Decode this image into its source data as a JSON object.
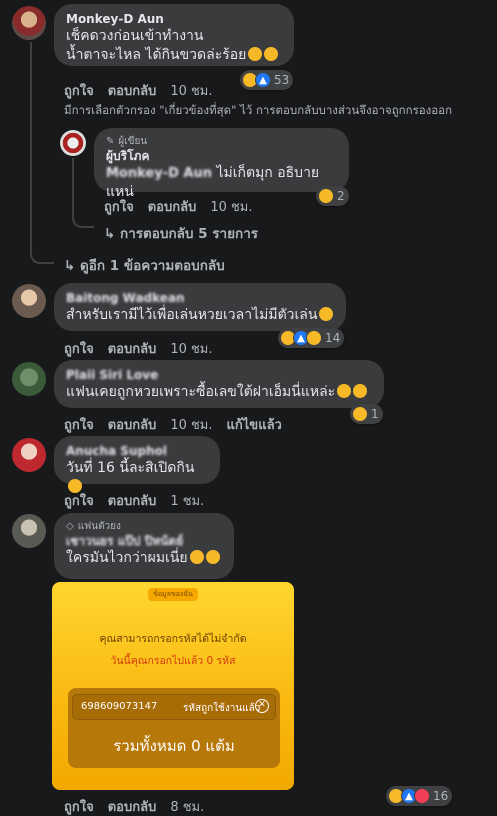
{
  "comments": [
    {
      "name": "Monkey-D Aun",
      "lines": [
        "เช็คดวงก่อนเข้าทำงาน",
        "น้ำตาจะไหล ได้กินขวดล่ะร้อย"
      ],
      "reaction_count": "53",
      "like": "ถูกใจ",
      "reply": "ตอบกลับ",
      "time": "10 ชม."
    },
    {
      "badge": "ผู้เขียน",
      "name": "ผู้บริโภค",
      "mention": "Monkey-D Aun",
      "text": "ไม่เก็ตมุก อธิบายแหน่",
      "reaction_count": "2",
      "like": "ถูกใจ",
      "reply": "ตอบกลับ",
      "time": "10 ชม."
    },
    {
      "name": "Baitong Wadkean",
      "text": "สำหรับเรามีไว้เพื่อเล่นหวยเวลาไม่มีตัวเล่น",
      "reaction_count": "14",
      "like": "ถูกใจ",
      "reply": "ตอบกลับ",
      "time": "10 ชม."
    },
    {
      "name": "Plaii Siri Love",
      "text": "แฟนเคยถูกหวยเพราะซื้อเลขใต้ฝาเอ็มนี่แหล่ะ",
      "reaction_count": "1",
      "like": "ถูกใจ",
      "reply": "ตอบกลับ",
      "time": "10 ชม.",
      "edited": "แก้ไขแล้ว"
    },
    {
      "name": "Anucha Suphol",
      "text": "วันที่ 16 นี้ละสิเปิดกิน",
      "like": "ถูกใจ",
      "reply": "ตอบกลับ",
      "time": "1 ชม."
    },
    {
      "badge": "แฟนตัวยง",
      "name": "เชาวนยร แป๊ป ปิหน้ดย์",
      "text": "ใครมันไวกว่าผมเนี่ย",
      "reaction_count": "16",
      "like": "ถูกใจ",
      "reply": "ตอบกลับ",
      "time": "8 ชม."
    }
  ],
  "filter_note": "มีการเลือกตัวกรอง \"เกี่ยวข้องที่สุด\" ไว้ การตอบกลับบางส่วนจึงอาจถูกกรองออก",
  "view_replies": "การตอบกลับ 5 รายการ",
  "view_more": "ดูอีก 1 ข้อความตอบกลับ",
  "card": {
    "tag": "ข้อมูลของฉัน",
    "line1": "คุณสามารถกรอกรหัสได้ไม่จำกัด",
    "line2": "วันนี้คุณกรอกไปแล้ว 0 รหัส",
    "code": "698609073147",
    "status": "รหัสถูกใช้งานแล้ว",
    "total": "รวมทั้งหมด 0 แต้ม"
  },
  "colors": {
    "background": "#18191a",
    "bubble": "#3a3b3c",
    "secondary_text": "#b0b3b8"
  },
  "icons": [
    "pencil-icon",
    "diamond-icon",
    "reply-arrow-icon",
    "close-icon",
    "haha-reaction-icon",
    "like-reaction-icon",
    "wow-reaction-icon",
    "love-reaction-icon"
  ]
}
